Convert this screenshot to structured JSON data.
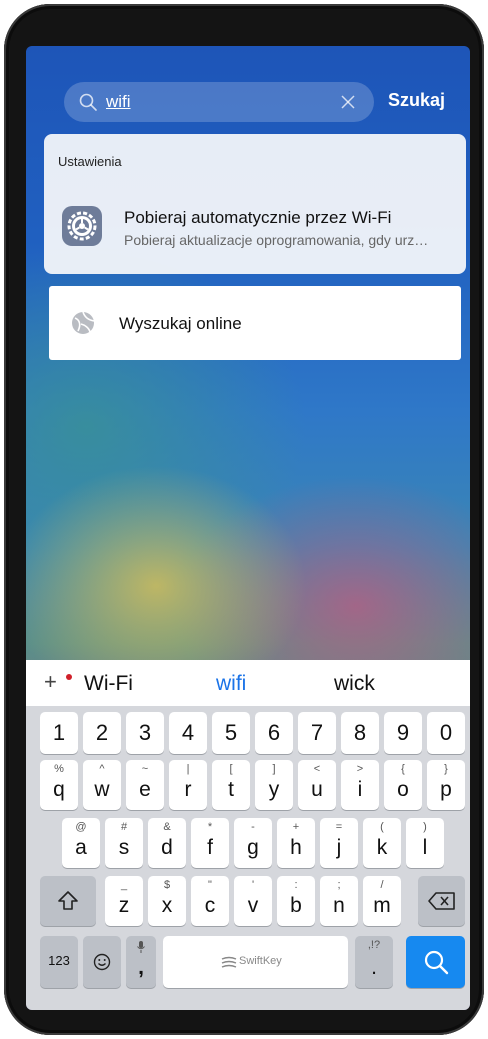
{
  "search": {
    "value": "wifi",
    "button_label": "Szukaj"
  },
  "results": {
    "section_label": "Ustawienia",
    "item": {
      "title": "Pobieraj automatycznie przez Wi-Fi",
      "subtitle": "Pobieraj aktualizacje oprogramowania, gdy urz…",
      "icon": "settings-gear-icon"
    }
  },
  "online_search": {
    "label": "Wyszukaj online",
    "icon": "globe-icon"
  },
  "keyboard": {
    "suggestions": [
      "Wi-Fi",
      "wifi",
      "wick"
    ],
    "active_suggestion_color": "#1a73e8",
    "number_row": [
      "1",
      "2",
      "3",
      "4",
      "5",
      "6",
      "7",
      "8",
      "9",
      "0"
    ],
    "row1": [
      {
        "main": "q",
        "sec": "%"
      },
      {
        "main": "w",
        "sec": "^"
      },
      {
        "main": "e",
        "sec": "~"
      },
      {
        "main": "r",
        "sec": "|"
      },
      {
        "main": "t",
        "sec": "["
      },
      {
        "main": "y",
        "sec": "]"
      },
      {
        "main": "u",
        "sec": "<"
      },
      {
        "main": "i",
        "sec": ">"
      },
      {
        "main": "o",
        "sec": "{"
      },
      {
        "main": "p",
        "sec": "}"
      }
    ],
    "row2": [
      {
        "main": "a",
        "sec": "@"
      },
      {
        "main": "s",
        "sec": "#"
      },
      {
        "main": "d",
        "sec": "&"
      },
      {
        "main": "f",
        "sec": "*"
      },
      {
        "main": "g",
        "sec": "-"
      },
      {
        "main": "h",
        "sec": "+"
      },
      {
        "main": "j",
        "sec": "="
      },
      {
        "main": "k",
        "sec": "("
      },
      {
        "main": "l",
        "sec": ")"
      }
    ],
    "row3": [
      {
        "main": "z",
        "sec": "_"
      },
      {
        "main": "x",
        "sec": "$"
      },
      {
        "main": "c",
        "sec": "\""
      },
      {
        "main": "v",
        "sec": "'"
      },
      {
        "main": "b",
        "sec": ":"
      },
      {
        "main": "n",
        "sec": ";"
      },
      {
        "main": "m",
        "sec": "/"
      }
    ],
    "bottom": {
      "numbers_label": "123",
      "comma": ",",
      "space_brand": "SwiftKey",
      "period": ".",
      "period_sec": ",!?"
    },
    "accent_color": "#1689f0"
  }
}
